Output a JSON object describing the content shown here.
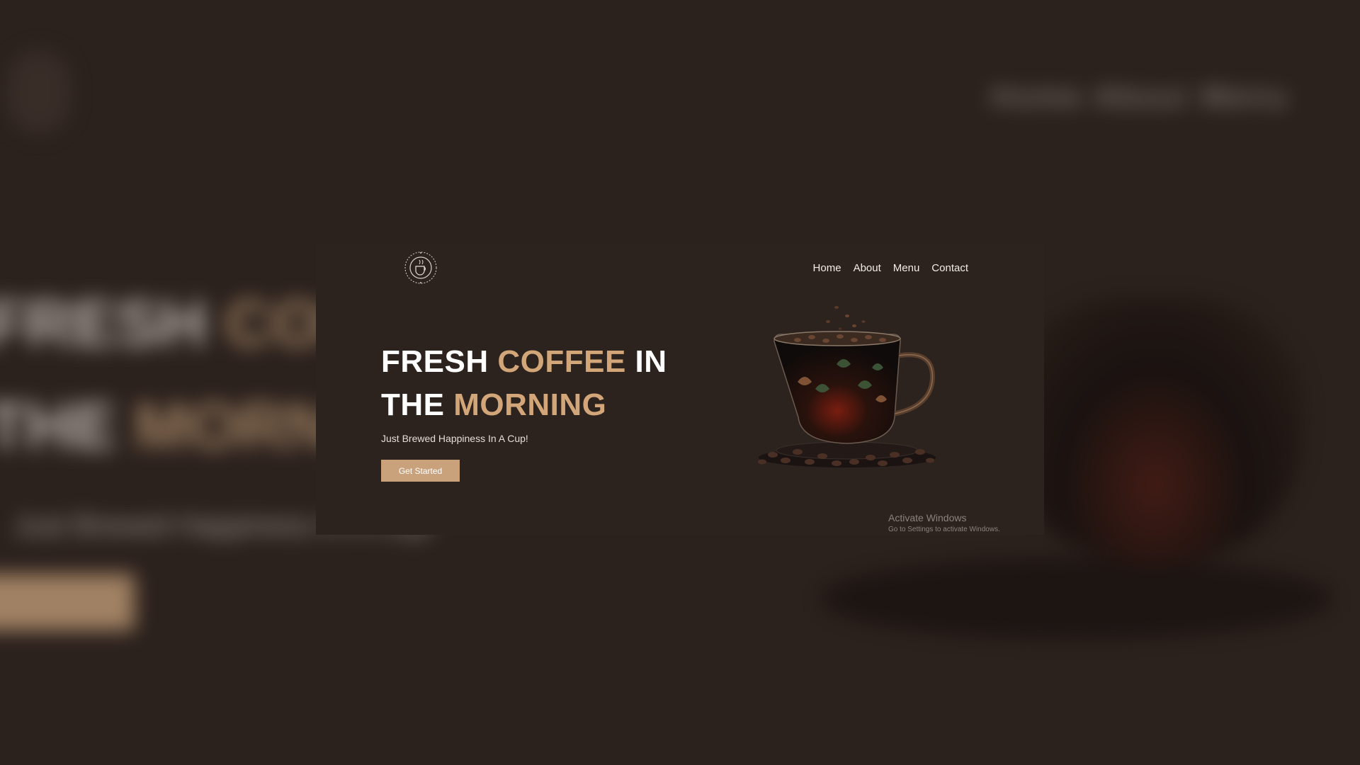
{
  "brand": {
    "accent_color": "#c9a27b",
    "background_color": "#2c231f",
    "logo_icon": "coffee-cup-emblem-icon"
  },
  "nav": {
    "items": [
      {
        "label": "Home"
      },
      {
        "label": "About"
      },
      {
        "label": "Menu"
      },
      {
        "label": "Contact"
      }
    ]
  },
  "hero": {
    "line1_part1": "FRESH ",
    "line1_accent": "COFFEE",
    "line1_part2": " IN",
    "line2_part1": "THE ",
    "line2_accent": "MORNING",
    "tagline": "Just Brewed Happiness In A Cup!",
    "cta_label": "Get Started",
    "image_icon": "coffee-cup-with-beans-icon"
  },
  "watermark": {
    "title": "Activate Windows",
    "subtitle": "Go to Settings to activate Windows."
  }
}
